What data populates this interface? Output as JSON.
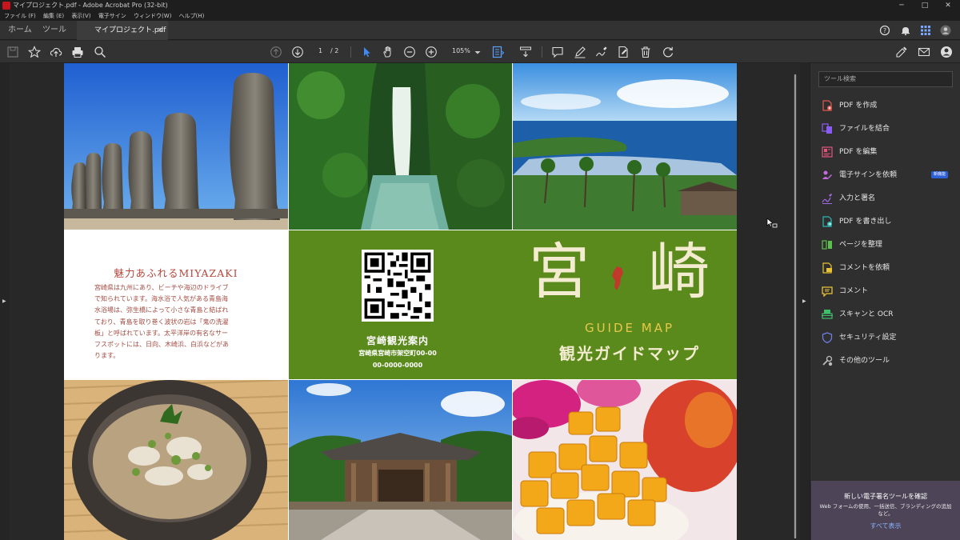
{
  "window": {
    "title": "マイプロジェクト.pdf - Adobe Acrobat Pro (32-bit)",
    "minimize": "─",
    "maximize": "□",
    "close": "✕"
  },
  "menu": [
    "ファイル (F)",
    "編集 (E)",
    "表示(V)",
    "電子サイン",
    "ウィンドウ(W)",
    "ヘルプ(H)"
  ],
  "tabs": {
    "home": "ホーム",
    "tools": "ツール",
    "document": "マイプロジェクト.pdf",
    "close": "×"
  },
  "toolbar": {
    "page_current": "1",
    "page_total": "/ 2",
    "zoom": "105%"
  },
  "right_panel": {
    "search_placeholder": "ツール検索",
    "tools": [
      {
        "label": "PDF を作成",
        "icon": "create-pdf-icon",
        "color": "#e05a4f"
      },
      {
        "label": "ファイルを結合",
        "icon": "combine-files-icon",
        "color": "#8a5cf6"
      },
      {
        "label": "PDF を編集",
        "icon": "edit-pdf-icon",
        "color": "#e5567c"
      },
      {
        "label": "電子サインを依頼",
        "icon": "request-esign-icon",
        "color": "#c46ae0",
        "badge": "新機能"
      },
      {
        "label": "入力と署名",
        "icon": "fill-sign-icon",
        "color": "#a26be8"
      },
      {
        "label": "PDF を書き出し",
        "icon": "export-pdf-icon",
        "color": "#2fb8b0"
      },
      {
        "label": "ページを整理",
        "icon": "organize-pages-icon",
        "color": "#5cbf4d"
      },
      {
        "label": "コメントを依頼",
        "icon": "request-comments-icon",
        "color": "#e9c234"
      },
      {
        "label": "コメント",
        "icon": "comment-icon",
        "color": "#e9c234"
      },
      {
        "label": "スキャンと OCR",
        "icon": "scan-ocr-icon",
        "color": "#3fbf6a"
      },
      {
        "label": "セキュリティ設定",
        "icon": "protect-icon",
        "color": "#6f7de0"
      },
      {
        "label": "その他のツール",
        "icon": "more-tools-icon",
        "color": "#bbbbbb"
      }
    ],
    "promo": {
      "title": "新しい電子署名ツールを確認",
      "text": "Web フォームの使用、一括送信、ブランディングの追加など。",
      "link": "すべて表示"
    }
  },
  "page": {
    "intro_title": "魅力あふれるMIYAZAKI",
    "intro_lines": [
      "宮崎県は九州にあり、ビーチや海辺のドライブ",
      "で知られています。海水浴で人気がある青島海",
      "水浴場は、弥生橋によって小さな青島と結ばれ",
      "ており、青島を取り巻く波状の岩は「鬼の洗濯",
      "板」と呼ばれています。太平洋岸の有名なサー",
      "フスポットには、日向、木崎浜、白浜などがあ",
      "ります。"
    ],
    "info_title": "宮崎観光案内",
    "info_address": "宮崎県宮崎市架空町00-00",
    "info_phone": "00-0000-0000",
    "guide_kanji_left": "宮",
    "guide_kanji_right": "崎",
    "guide_en": "GUIDE MAP",
    "guide_jp": "観光ガイドマップ",
    "colors": {
      "green": "#5b8a1c",
      "intro_red": "#b8443a",
      "cream": "#f4ecd0"
    }
  }
}
